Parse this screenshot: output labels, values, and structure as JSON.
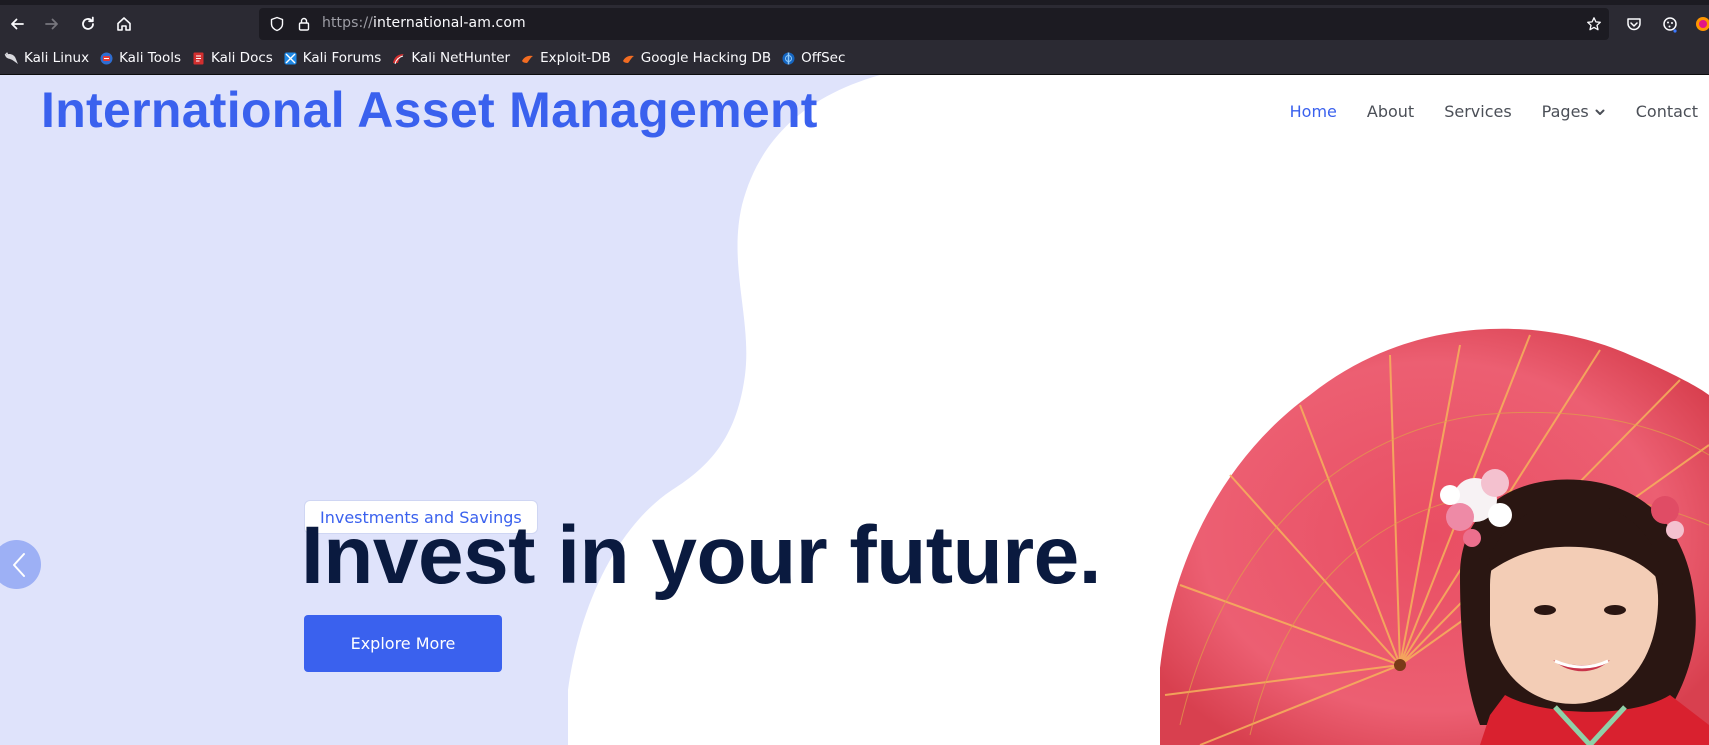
{
  "browser": {
    "url_scheme": "https://",
    "url_host": "international-am.com",
    "bookmarks": [
      {
        "label": "Kali Linux",
        "icon": "kali-dragon-icon"
      },
      {
        "label": "Kali Tools",
        "icon": "kali-tools-icon"
      },
      {
        "label": "Kali Docs",
        "icon": "kali-docs-icon"
      },
      {
        "label": "Kali Forums",
        "icon": "kali-forums-icon"
      },
      {
        "label": "Kali NetHunter",
        "icon": "kali-nethunter-icon"
      },
      {
        "label": "Exploit-DB",
        "icon": "exploit-db-icon"
      },
      {
        "label": "Google Hacking DB",
        "icon": "ghdb-icon"
      },
      {
        "label": "OffSec",
        "icon": "offsec-icon"
      }
    ]
  },
  "site": {
    "brand": "International Asset Management",
    "nav": [
      {
        "label": "Home",
        "active": true
      },
      {
        "label": "About",
        "active": false
      },
      {
        "label": "Services",
        "active": false
      },
      {
        "label": "Pages",
        "active": false,
        "has_dropdown": true
      },
      {
        "label": "Contact",
        "active": false
      }
    ]
  },
  "hero": {
    "tagline": "Investments and Savings",
    "headline": "Invest in your future.",
    "cta_label": "Explore More",
    "image": "woman-with-red-parasol"
  },
  "colors": {
    "accent": "#3a61ee",
    "blob": "#dfe3fb",
    "headline": "#0a1a3f",
    "chrome_bg": "#2b2a33",
    "urlbar_bg": "#1c1b22"
  }
}
